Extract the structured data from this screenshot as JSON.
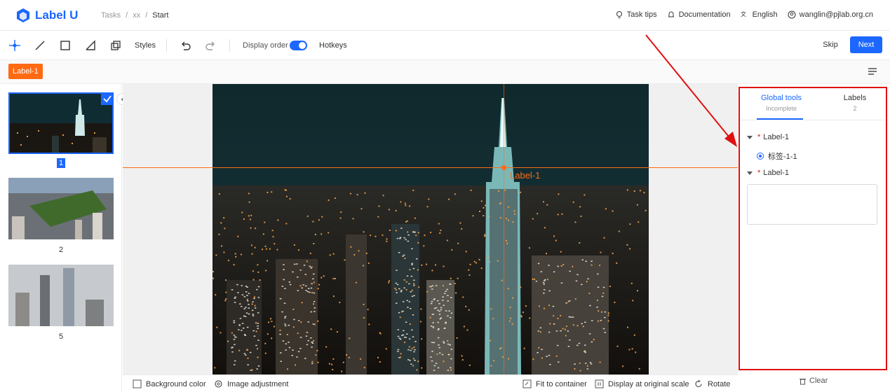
{
  "app": {
    "name": "Label U"
  },
  "breadcrumb": {
    "root": "Tasks",
    "sep1": "/",
    "middle": "xx",
    "sep2": "/",
    "current": "Start"
  },
  "header_right": {
    "task_tips": "Task tips",
    "documentation": "Documentation",
    "language": "English",
    "user": "wanglin@pjlab.org.cn"
  },
  "toolbar": {
    "styles_label": "Styles",
    "display_order_label": "Display order",
    "display_order_on": true,
    "hotkeys_label": "Hotkeys",
    "skip_label": "Skip",
    "next_label": "Next"
  },
  "label_bar": {
    "active_label": "Label-1"
  },
  "sidebar": {
    "items": [
      {
        "number": "1",
        "selected": true
      },
      {
        "number": "2",
        "selected": false
      },
      {
        "number": "5",
        "selected": false
      }
    ]
  },
  "canvas": {
    "point_label": "Label-1"
  },
  "bottom_bar": {
    "background_color": "Background color",
    "image_adjustment": "Image adjustment",
    "fit_to_container": "Fit to container",
    "display_original_scale": "Display at original scale",
    "rotate": "Rotate"
  },
  "right_panel": {
    "tabs": [
      {
        "label": "Global tools",
        "sub": "Incomplete"
      },
      {
        "label": "Labels",
        "sub": "2"
      }
    ],
    "attributes": [
      {
        "required": "*",
        "name": "Label-1",
        "option": "标签-1-1"
      },
      {
        "required": "*",
        "name": "Label-1",
        "text_value": ""
      }
    ],
    "clear_label": "Clear"
  },
  "colors": {
    "accent": "#1b67ff",
    "label": "#ff6a13",
    "highlight_box": "#e01010"
  }
}
